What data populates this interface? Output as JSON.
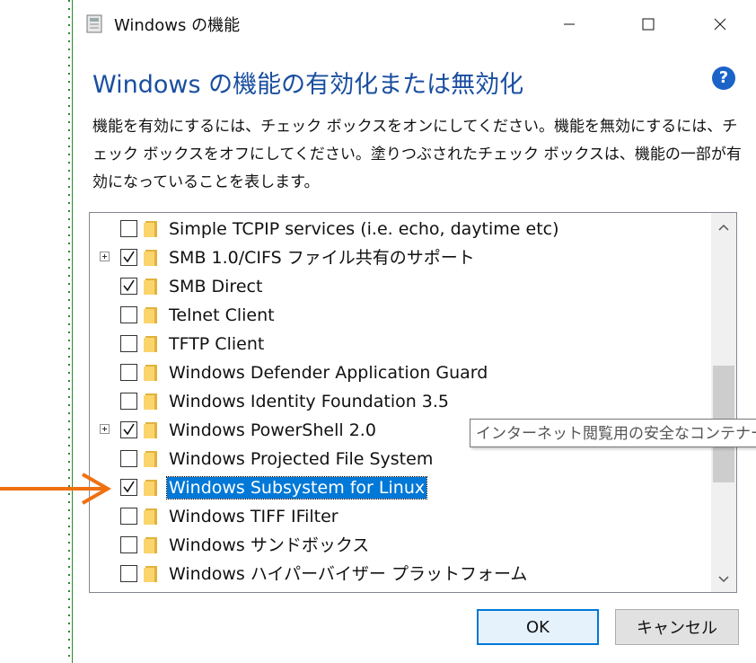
{
  "window": {
    "title": "Windows の機能",
    "heading": "Windows の機能の有効化または無効化",
    "help_label": "?",
    "description": "機能を有効にするには、チェック ボックスをオンにしてください。機能を無効にするには、チェック ボックスをオフにしてください。塗りつぶされたチェック ボックスは、機能の一部が有効になっていることを表します。",
    "controls": {
      "minimize_icon": "minimize-icon",
      "maximize_icon": "maximize-icon",
      "close_icon": "close-icon"
    }
  },
  "features": [
    {
      "label": "Simple TCPIP services (i.e. echo, daytime etc)",
      "checked": false,
      "expandable": false,
      "selected": false
    },
    {
      "label": "SMB 1.0/CIFS ファイル共有のサポート",
      "checked": true,
      "expandable": true,
      "selected": false
    },
    {
      "label": "SMB Direct",
      "checked": true,
      "expandable": false,
      "selected": false
    },
    {
      "label": "Telnet Client",
      "checked": false,
      "expandable": false,
      "selected": false
    },
    {
      "label": "TFTP Client",
      "checked": false,
      "expandable": false,
      "selected": false
    },
    {
      "label": "Windows Defender Application Guard",
      "checked": false,
      "expandable": false,
      "selected": false
    },
    {
      "label": "Windows Identity Foundation 3.5",
      "checked": false,
      "expandable": false,
      "selected": false
    },
    {
      "label": "Windows PowerShell 2.0",
      "checked": true,
      "expandable": true,
      "selected": false
    },
    {
      "label": "Windows Projected File System",
      "checked": false,
      "expandable": false,
      "selected": false
    },
    {
      "label": "Windows Subsystem for Linux",
      "checked": true,
      "expandable": false,
      "selected": true
    },
    {
      "label": "Windows TIFF IFilter",
      "checked": false,
      "expandable": false,
      "selected": false
    },
    {
      "label": "Windows サンドボックス",
      "checked": false,
      "expandable": false,
      "selected": false
    },
    {
      "label": "Windows ハイパーバイザー プラットフォーム",
      "checked": false,
      "expandable": false,
      "selected": false
    },
    {
      "label": "",
      "checked": false,
      "expandable": true,
      "selected": false
    }
  ],
  "tooltip": "インターネット閲覧用の安全なコンテナー",
  "buttons": {
    "ok": "OK",
    "cancel": "キャンセル"
  },
  "colors": {
    "heading": "#1a4fa0",
    "selection": "#0078d7",
    "annotation_arrow": "#f07010",
    "help_icon": "#1b63c7"
  }
}
